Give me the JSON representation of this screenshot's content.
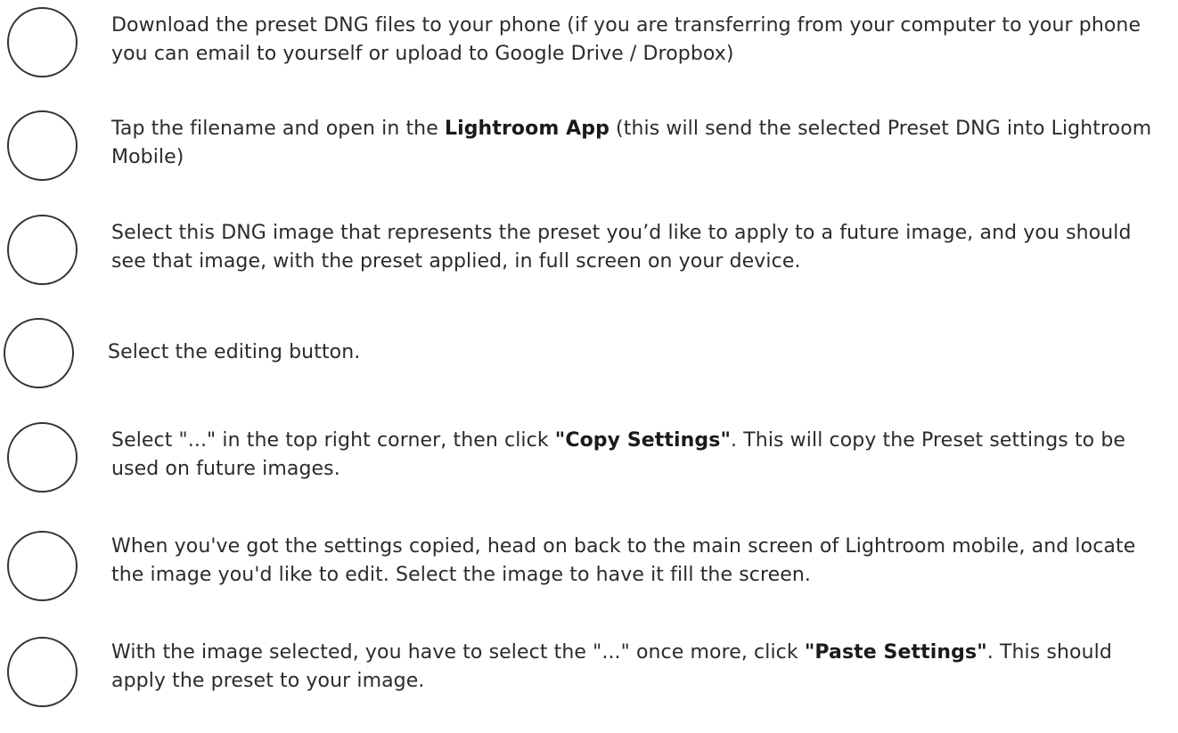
{
  "steps": [
    {
      "checked": false,
      "parts": [
        "Download the preset DNG files to your phone (if you are transferring from your computer to your phone you can email to yourself or upload to Google Drive / Dropbox)"
      ]
    },
    {
      "checked": false,
      "parts": [
        "Tap the filename and open in the ",
        "Lightroom App",
        " (this will send the selected Preset DNG into Lightroom Mobile)"
      ]
    },
    {
      "checked": false,
      "parts": [
        "Select this DNG image that represents the preset you’d like to apply to a future image, and you should see that image, with the preset applied, in full screen on your device."
      ]
    },
    {
      "checked": false,
      "parts": [
        "Select the editing button."
      ]
    },
    {
      "checked": false,
      "parts": [
        "Select \"...\" in the top right corner, then click ",
        "\"Copy Settings\"",
        ". This will copy the Preset settings to be used on future images."
      ]
    },
    {
      "checked": false,
      "parts": [
        "When you've got the settings copied, head on back to the main screen of Lightroom mobile, and locate the image you'd like to edit. Select the image to have it fill the screen."
      ]
    },
    {
      "checked": false,
      "parts": [
        "With the image selected, you have to select the \"...\" once more, click ",
        "\"Paste Settings\"",
        ". This should apply the preset to your image."
      ]
    }
  ]
}
